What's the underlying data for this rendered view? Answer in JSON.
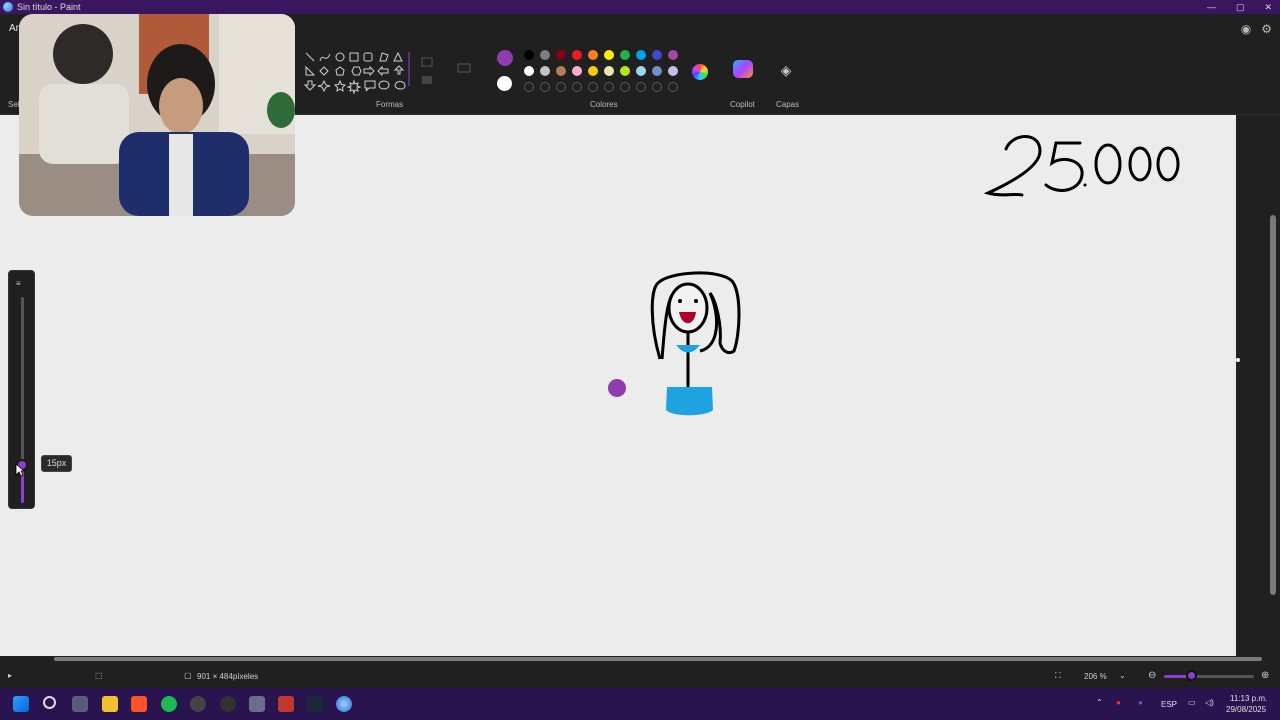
{
  "window": {
    "title": "Sin título - Paint"
  },
  "menu": {
    "file": "Arch"
  },
  "ribbon": {
    "selection_label": "Sel",
    "shapes_label": "Formas",
    "colors_label": "Colores",
    "copilot_label": "Copilot",
    "layers_label": "Capas",
    "primary_color": "#8e3cb0",
    "secondary_color": "#ffffff",
    "palette_row1": [
      "#000000",
      "#7f7f7f",
      "#880015",
      "#ed1c24",
      "#ff7f27",
      "#fff200",
      "#22b14c",
      "#00a2e8",
      "#3f48cc",
      "#a349a4"
    ],
    "palette_row2": [
      "#ffffff",
      "#c3c3c3",
      "#b97a57",
      "#ffaec9",
      "#ffc90e",
      "#efe4b0",
      "#b5e61d",
      "#99d9ea",
      "#7092be",
      "#c8bfe7"
    ]
  },
  "brush": {
    "size_tooltip": "15px",
    "size_value": 15
  },
  "canvas": {
    "annotation_text": "25.000",
    "background": "#ececec"
  },
  "status": {
    "dimensions": "901 × 484píxeles",
    "zoom": "206 %",
    "zoom_level": 0.3
  },
  "taskbar": {
    "language": "ESP",
    "time": "11:13 p.m.",
    "date": "29/08/2025"
  },
  "colors": {
    "accent": "#8b3fd0",
    "titlebar": "#3a1560",
    "taskbar": "#2a1450"
  }
}
